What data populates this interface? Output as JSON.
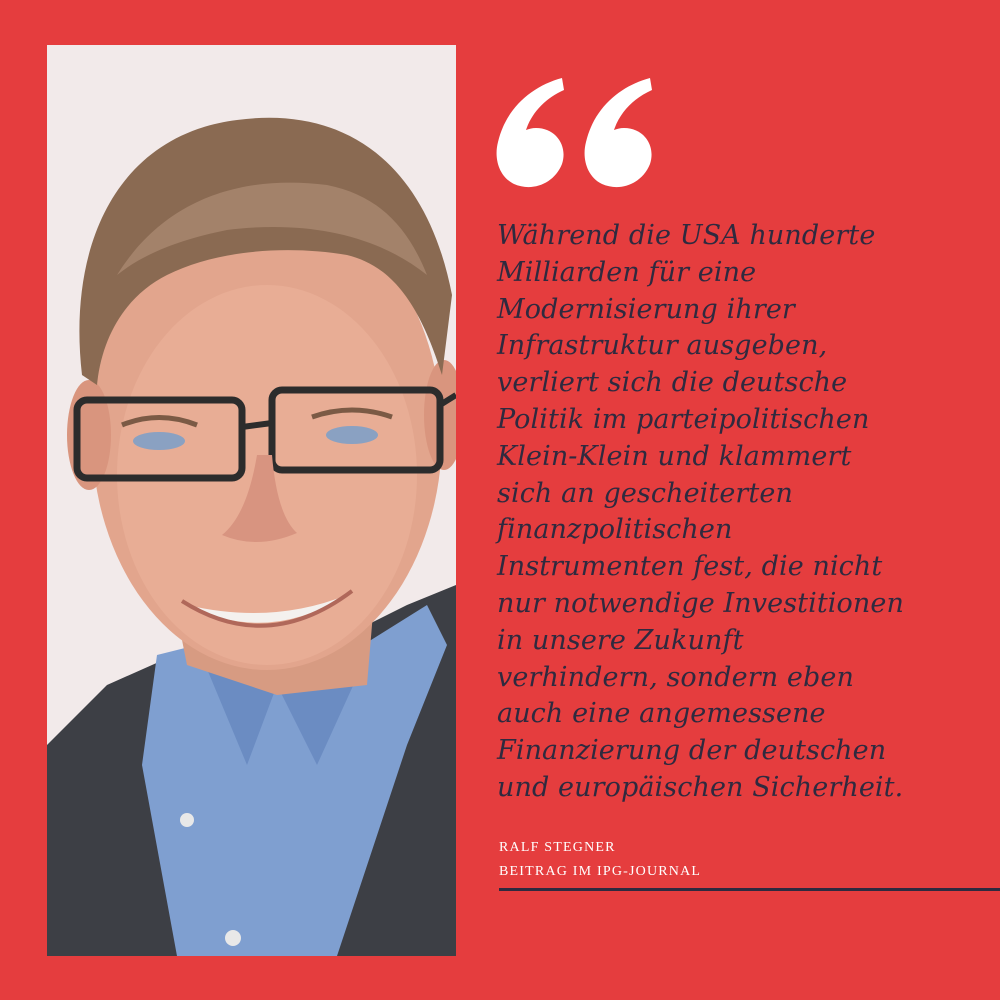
{
  "quote": {
    "lines": [
      "Während die USA hunderte",
      "Milliarden für eine",
      "Modernisierung ihrer",
      "Infrastruktur ausgeben,",
      "verliert sich die deutsche",
      "Politik im parteipolitischen",
      "Klein-Klein und klammert",
      "sich an gescheiterten",
      "finanzpolitischen",
      "Instrumenten fest, die nicht",
      "nur notwendige Investitionen",
      "in unsere Zukunft",
      "verhindern, sondern eben",
      "auch eine angemessene",
      "Finanzierung der deutschen",
      "und europäischen Sicherheit."
    ]
  },
  "attribution": {
    "name": "RALF STEGNER",
    "source": "BEITRAG IM IPG-JOURNAL"
  },
  "icons": {
    "quote": "opening-quote-icon"
  },
  "colors": {
    "background": "#e53d3e",
    "text": "#2f2a3f",
    "accent_white": "#ffffff"
  }
}
